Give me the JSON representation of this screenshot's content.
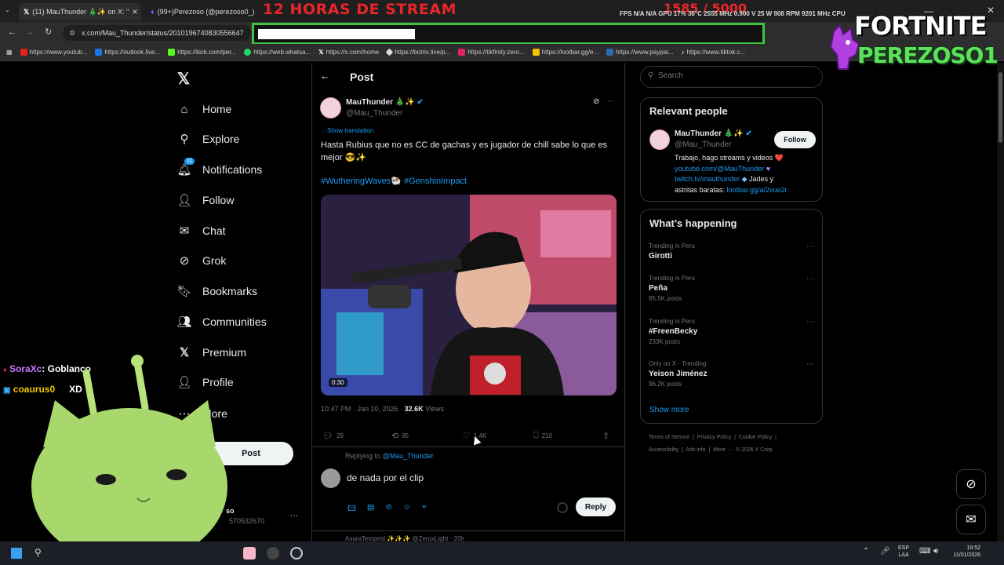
{
  "browser": {
    "tabs": [
      {
        "label": "(11) MauThunder 🎄✨ on X: \"",
        "active": true
      },
      {
        "label": "(99+)Perezoso (@perezoso0_) |",
        "active": false
      }
    ],
    "url": "x.com/Mau_Thunder/status/2010196740830556647",
    "bookmarks": [
      "https://www.youtub...",
      "https://outlook.live...",
      "https://kick.com/per...",
      "https://web.whatsa...",
      "https://x.com/home",
      "https://botrix.live/p...",
      "https://tikfinity.zero...",
      "https://lootbar.gg/e...",
      "https://www.paypal...",
      "https://www.tiktok.c..."
    ]
  },
  "stream_overlay": {
    "banner": "12 HORAS DE STREAM",
    "counter": "1585 / 5000",
    "stats": "FPS N/A N/A    GPU 17% 36°C 2555 MHz 0.900 V 25 W 908 RPM 9201 MHz    CPU 35%  AT N/A N/A",
    "logo_line1": "FORTNITE",
    "logo_line2": "PEREZOSO1",
    "chat": [
      {
        "user": "SoraXc",
        "text": ": Goblanco"
      },
      {
        "user": "coaurus0",
        "text": "XD"
      }
    ]
  },
  "nav": {
    "items": [
      {
        "label": "Home",
        "icon": "home-icon"
      },
      {
        "label": "Explore",
        "icon": "search-icon"
      },
      {
        "label": "Notifications",
        "icon": "bell-icon",
        "badge": "11"
      },
      {
        "label": "Follow",
        "icon": "follow-icon"
      },
      {
        "label": "Chat",
        "icon": "mail-icon"
      },
      {
        "label": "Grok",
        "icon": "grok-icon"
      },
      {
        "label": "Bookmarks",
        "icon": "bookmark-icon"
      },
      {
        "label": "Communities",
        "icon": "communities-icon"
      },
      {
        "label": "Premium",
        "icon": "x-icon"
      },
      {
        "label": "Profile",
        "icon": "profile-icon"
      },
      {
        "label": "More",
        "icon": "more-icon"
      }
    ],
    "post_button": "Post",
    "account_name": "so",
    "account_handle": "570532670"
  },
  "post": {
    "header": "Post",
    "author_name": "MauThunder 🎄✨",
    "author_handle": "@Mau_Thunder",
    "show_translation": "Show translation",
    "text": "Hasta Rubius que no es CC de gachas y es jugador de chill sabe lo que es mejor 😎✨",
    "hashtags": "#WutheringWaves🐏 #GenshinImpact",
    "video_duration": "0:30",
    "timestamp": "10:47 PM · Jan 10, 2026 · ",
    "views_count": "32.6K",
    "views_label": " Views",
    "replies": "29",
    "reposts": "95",
    "likes": "1.4K",
    "bookmarks": "210",
    "replying_to_prefix": "Replying to ",
    "replying_to": "@Mau_Thunder",
    "reply_draft": "de nada por el clip",
    "reply_button": "Reply",
    "next_post_preview": "AsuraTempest ✨✨✨ @ZeroxLight · 20h"
  },
  "right": {
    "search_placeholder": "Search",
    "relevant_title": "Relevant people",
    "person_name": "MauThunder 🎄✨",
    "person_handle": "@Mau_Thunder",
    "follow_label": "Follow",
    "bio_line1": "Trabajo, hago streams y videos ❤️",
    "bio_link1": "youtube.com/@MauThunder",
    "bio_link2": "twitch.tv/mauthunder",
    "bio_line3": " Jades y",
    "bio_line4": "astritas baratas: ",
    "bio_link3": "lootbar.gg/a/2vue2r",
    "happening_title": "What’s happening",
    "trends": [
      {
        "context": "Trending in Peru",
        "name": "Girotti",
        "posts": ""
      },
      {
        "context": "Trending in Peru",
        "name": "Peña",
        "posts": "85.5K posts"
      },
      {
        "context": "Trending in Peru",
        "name": "#FreenBecky",
        "posts": "233K posts"
      },
      {
        "context": "Only on X · Trending",
        "name": "Yeison Jiménez",
        "posts": "96.2K posts"
      }
    ],
    "show_more": "Show more",
    "footer_line1": "Terms of Service  |  Privacy Policy  |  Cookie Policy  |",
    "footer_line2": "Accessibility  |  Ads info  |  More ···  © 2026 X Corp."
  },
  "taskbar": {
    "lang1": "ESP",
    "lang2": "LAA",
    "time": "19:52",
    "date": "11/01/2026"
  },
  "colors": {
    "accent": "#1d9bf0",
    "background": "#000000",
    "overlay_red": "#e8262a",
    "address_highlight": "#3ec43e"
  }
}
